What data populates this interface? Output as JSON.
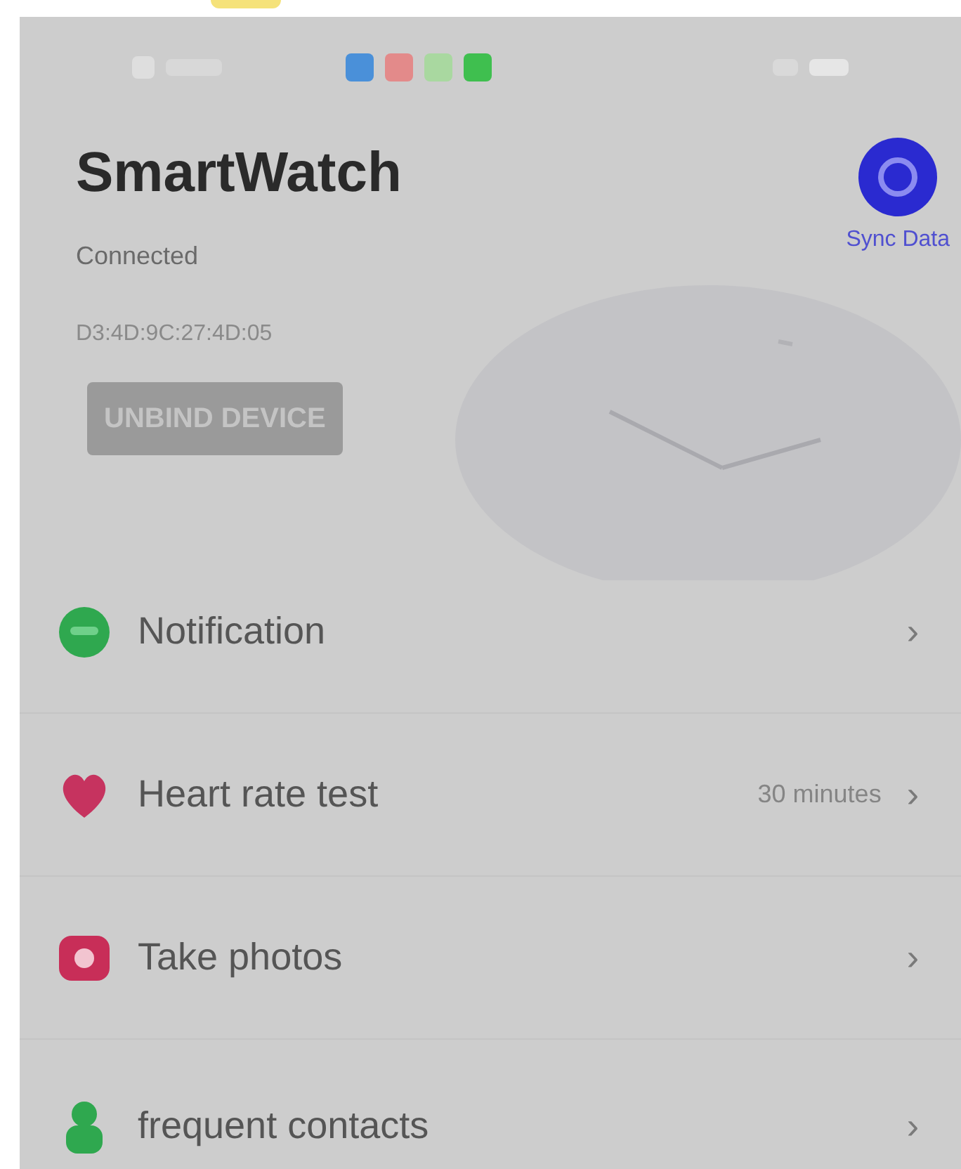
{
  "status_bar": {
    "app_icons": [
      {
        "color": "#4a90d9"
      },
      {
        "color": "#e38a8a"
      },
      {
        "color": "#a9d8a0"
      },
      {
        "color": "#3fbf4f"
      }
    ]
  },
  "device": {
    "name": "SmartWatch",
    "status": "Connected",
    "address": "D3:4D:9C:27:4D:05",
    "unbind_button": "UNBIND DEVICE",
    "sync_label": "Sync Data"
  },
  "menu": [
    {
      "kind": "chat",
      "label": "Notification",
      "chevron": "›"
    },
    {
      "kind": "heart",
      "label": "Heart rate test",
      "value": "30 minutes",
      "chevron": "›"
    },
    {
      "kind": "camera",
      "label": "Take photos",
      "chevron": "›"
    },
    {
      "kind": "person",
      "label": "frequent contacts",
      "chevron": "›"
    }
  ]
}
